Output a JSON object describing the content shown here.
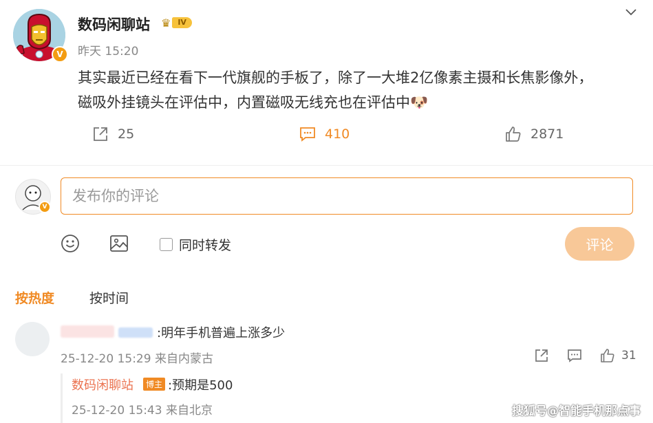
{
  "post": {
    "author": "数码闲聊站",
    "level_badge": "IV",
    "verified_badge": "V",
    "time": "昨天 15:20",
    "text_line1": "其实最近已经在看下一代旗舰的手板了，除了一大堆2亿像素主摄和长焦影像外，",
    "text_line2": "磁吸外挂镜头在评估中，内置磁吸无线充也在评估中",
    "emoji": "🐶",
    "reposts": "25",
    "comments": "410",
    "likes": "2871"
  },
  "composer": {
    "placeholder": "发布你的评论",
    "repost_label": "同时转发",
    "submit_label": "评论"
  },
  "sort": {
    "hot_label": "按热度",
    "time_label": "按时间"
  },
  "comments": [
    {
      "text": ":明年手机普遍上涨多少",
      "meta": "25-12-20 15:29 来自内蒙古",
      "likes": "31",
      "reply": {
        "author": "数码闲聊站",
        "tag": "博主",
        "text": ":预期是500",
        "meta": "25-12-20 15:43 来自北京"
      }
    }
  ],
  "watermark": "搜狐号@智能手机那点事",
  "colors": {
    "accent": "#f08a24",
    "reply_name": "#eb7350",
    "submit_disabled": "#f8c898",
    "muted": "#888888"
  }
}
